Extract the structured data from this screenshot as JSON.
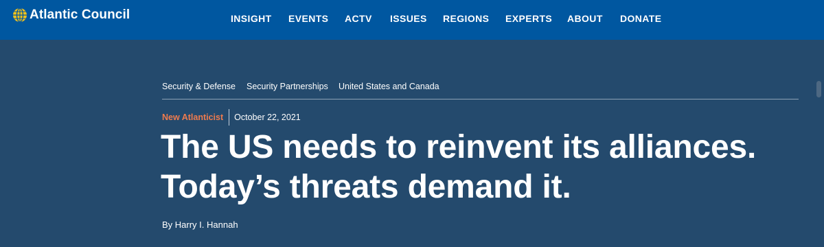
{
  "brand": {
    "name": "Atlantic Council",
    "icon": "globe-icon",
    "icon_color": "#f2c21b"
  },
  "nav": {
    "items": [
      {
        "label": "INSIGHT"
      },
      {
        "label": "EVENTS"
      },
      {
        "label": "ACTV"
      },
      {
        "label": "ISSUES"
      },
      {
        "label": "REGIONS"
      },
      {
        "label": "EXPERTS"
      },
      {
        "label": "ABOUT"
      },
      {
        "label": "DONATE"
      }
    ]
  },
  "article": {
    "tags": [
      {
        "label": "Security & Defense"
      },
      {
        "label": "Security Partnerships"
      },
      {
        "label": "United States and Canada"
      }
    ],
    "section": "New Atlanticist",
    "date": "October 22, 2021",
    "title_line1": "The US needs to reinvent its alliances.",
    "title_line2": "Today’s threats demand it.",
    "byline": "By Harry I. Hannah"
  },
  "colors": {
    "nav_background": "#0057a0",
    "hero_background": "#244a6d",
    "section_accent": "#ee7b4e"
  }
}
